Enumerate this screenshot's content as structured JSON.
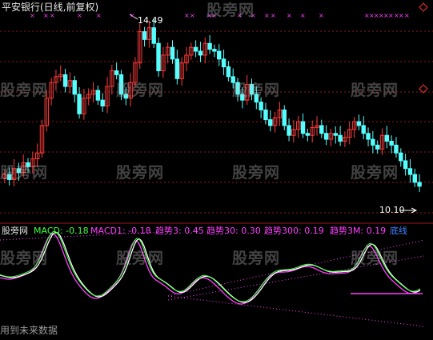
{
  "title": "平安银行(日线,前复权)",
  "price_high_label": "14.49",
  "price_low_label": "10.10",
  "indicator_labels": {
    "source": "股旁网",
    "macd": "MACD: -0.18",
    "macd1": "MACD1: -0.18",
    "trend3": "趋势3: 0.45",
    "trend30": "趋势30: 0.30",
    "trend300": "趋势300: 0.19",
    "trend3m": "趋势3M: 0.19",
    "bottom": "底线"
  },
  "watermark": "股旁网",
  "footer_text": "用到未来数据",
  "colors": {
    "background": "#000000",
    "up_candle": "#ff3a3a",
    "down_candle": "#54ffff",
    "grid": "#8a1a1a",
    "macd_line": "#ffffff",
    "macd1_line": "#ff40ff",
    "green_line": "#40ff40",
    "trend_label": "#ff40ff",
    "marker": "#ff40ff",
    "bottom_label": "#4080ff"
  },
  "chart_data": {
    "type": "candlestick",
    "title": "平安银行(日线,前复权)",
    "annotations": [
      {
        "text": "14.49",
        "kind": "high"
      },
      {
        "text": "10.10",
        "kind": "low"
      }
    ],
    "closes": [
      10.55,
      10.42,
      10.7,
      10.6,
      10.85,
      10.75,
      10.95,
      11.1,
      11.8,
      12.5,
      12.9,
      13.05,
      13.1,
      12.8,
      12.95,
      12.6,
      12.1,
      12.5,
      12.6,
      12.7,
      12.45,
      12.3,
      12.8,
      13.2,
      13.1,
      12.6,
      12.5,
      12.9,
      13.4,
      14.2,
      14.0,
      14.3,
      13.9,
      13.2,
      13.6,
      13.8,
      13.5,
      13.0,
      13.4,
      13.6,
      13.8,
      13.7,
      13.6,
      13.9,
      13.75,
      13.7,
      13.5,
      13.3,
      13.05,
      12.9,
      12.6,
      12.45,
      12.85,
      12.6,
      12.4,
      12.2,
      11.95,
      11.8,
      12.0,
      12.2,
      11.8,
      11.55,
      11.7,
      11.9,
      11.6,
      11.55,
      11.75,
      11.8,
      11.6,
      11.45,
      11.6,
      11.55,
      11.4,
      11.5,
      11.7,
      11.9,
      11.8,
      11.6,
      11.45,
      11.3,
      11.2,
      11.55,
      11.4,
      11.3,
      11.1,
      10.9,
      10.7,
      10.55,
      10.35,
      10.25
    ]
  }
}
